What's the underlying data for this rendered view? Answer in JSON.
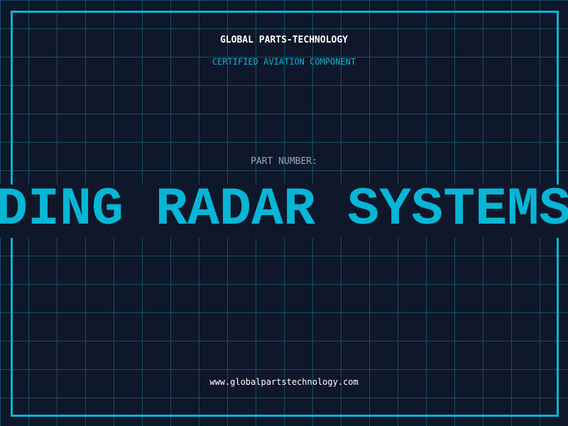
{
  "header": {
    "brand": "GLOBAL PARTS-TECHNOLOGY",
    "subtitle": "CERTIFIED AVIATION COMPONENT"
  },
  "part": {
    "label": "PART NUMBER:",
    "value": "DING RADAR SYSTEMS"
  },
  "footer": {
    "url": "www.globalpartstechnology.com"
  },
  "colors": {
    "background": "#0f172a",
    "grid": "#164e63",
    "accent": "#06b6d4"
  }
}
